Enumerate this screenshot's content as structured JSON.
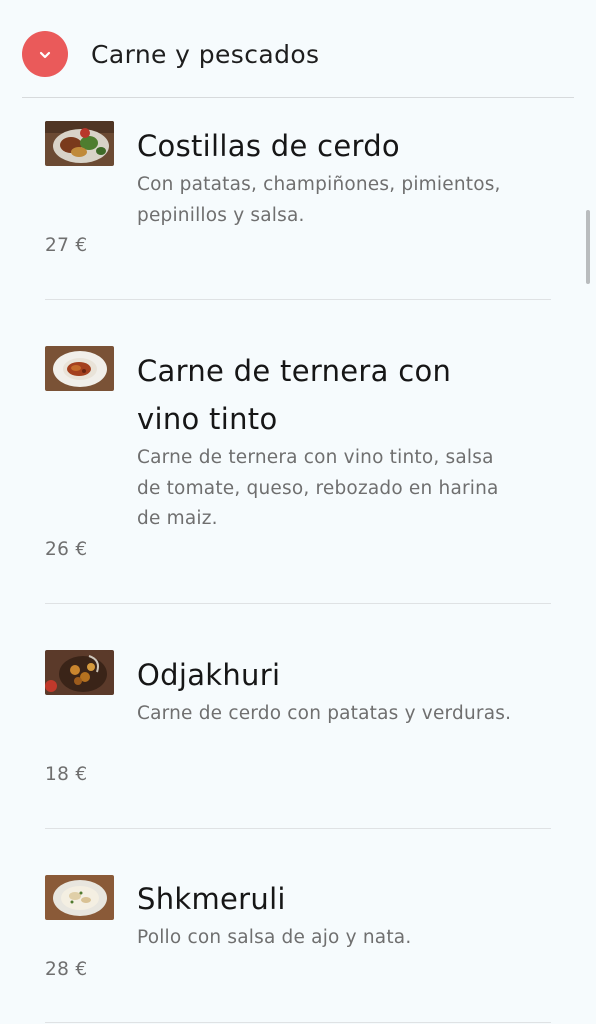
{
  "section": {
    "title": "Carne y pescados",
    "toggle_icon": "chevron-down-icon",
    "accent_color": "#ea5a5a"
  },
  "items": [
    {
      "name": "Costillas de cerdo",
      "description": "Con patatas, champiñones, pimientos, pepinillos y salsa.",
      "price": "27 €",
      "image": "pork-ribs-photo"
    },
    {
      "name": "Carne de ternera con vino tinto",
      "description": "Carne de ternera con vino tinto, salsa de tomate, queso, rebozado en harina de maiz.",
      "price": "26 €",
      "image": "beef-stew-photo"
    },
    {
      "name": "Odjakhuri",
      "description": "Carne de cerdo con patatas y verduras.",
      "price": "18 €",
      "image": "odjakhuri-photo"
    },
    {
      "name": "Shkmeruli",
      "description": "Pollo con salsa de ajo y nata.",
      "price": "28 €",
      "image": "shkmeruli-photo"
    }
  ]
}
